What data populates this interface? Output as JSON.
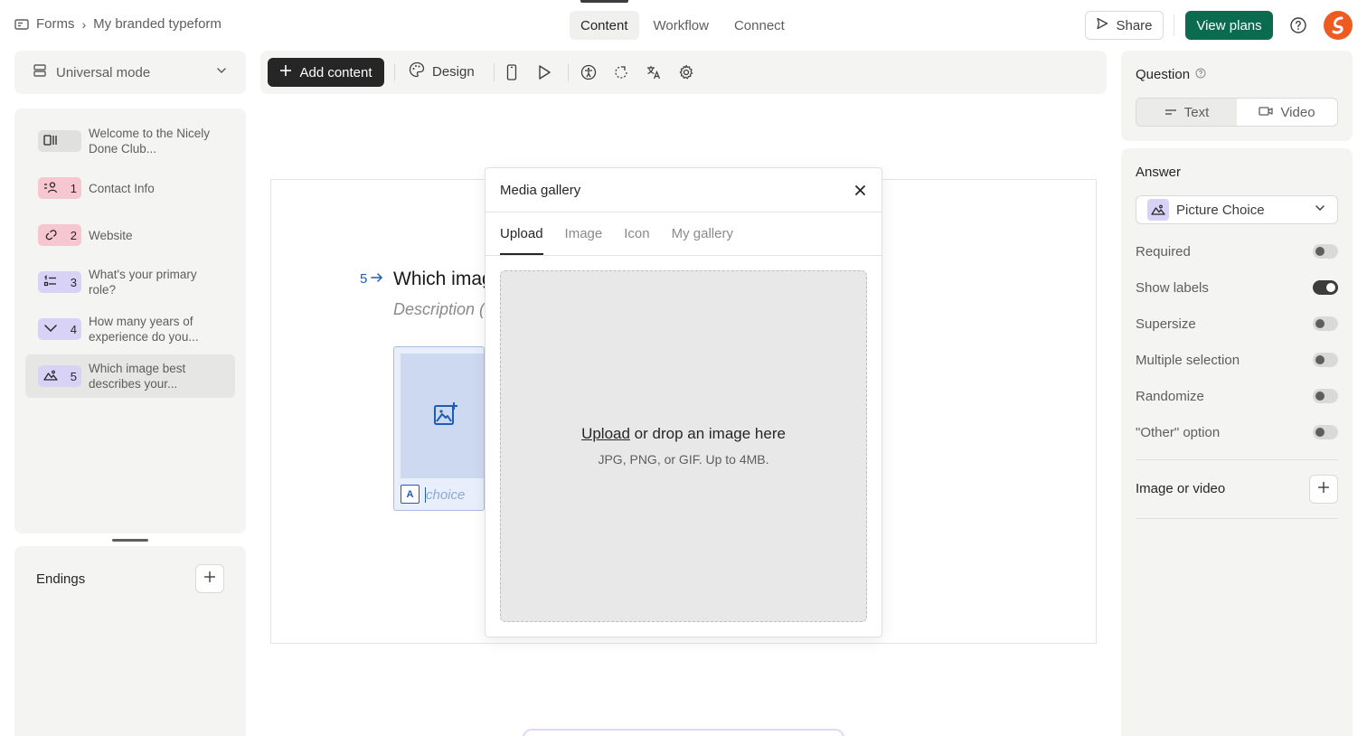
{
  "breadcrumb": {
    "root": "Forms",
    "current": "My branded typeform"
  },
  "header": {
    "tabs": [
      {
        "label": "Content"
      },
      {
        "label": "Workflow"
      },
      {
        "label": "Connect"
      }
    ],
    "share_label": "Share",
    "plans_label": "View plans",
    "brand_color": "#0a6b4f",
    "avatar_color": "#ee5b20"
  },
  "mode": {
    "label": "Universal mode"
  },
  "questions": [
    {
      "num": "",
      "text": "Welcome to the Nicely Done Club...",
      "icon": "welcome-icon",
      "color": "gray"
    },
    {
      "num": "1",
      "text": "Contact Info",
      "icon": "contact-icon",
      "color": "pink"
    },
    {
      "num": "2",
      "text": "Website",
      "icon": "link-icon",
      "color": "pink"
    },
    {
      "num": "3",
      "text": "What's your primary role?",
      "icon": "list-icon",
      "color": "purple"
    },
    {
      "num": "4",
      "text": "How many years of experience do you...",
      "icon": "chevron-down-icon",
      "color": "purple"
    },
    {
      "num": "5",
      "text": "Which image best describes your...",
      "icon": "picture-choice-icon",
      "color": "purple"
    }
  ],
  "endings": {
    "label": "Endings"
  },
  "toolbar": {
    "add_label": "Add content",
    "design_label": "Design"
  },
  "canvas": {
    "q_num": "5",
    "q_title": "Which imag",
    "q_desc": "Description (",
    "choice_key": "A",
    "choice_placeholder": "choice"
  },
  "modal": {
    "title": "Media gallery",
    "tabs": [
      {
        "label": "Upload"
      },
      {
        "label": "Image"
      },
      {
        "label": "Icon"
      },
      {
        "label": "My gallery"
      }
    ],
    "upload_link": "Upload",
    "upload_text": " or drop an image here",
    "upload_sub": "JPG, PNG, or GIF. Up to 4MB."
  },
  "right": {
    "question_label": "Question",
    "seg": [
      {
        "label": "Text"
      },
      {
        "label": "Video"
      }
    ],
    "answer_label": "Answer",
    "answer_type": "Picture Choice",
    "options": [
      {
        "label": "Required",
        "on": false
      },
      {
        "label": "Show labels",
        "on": true
      },
      {
        "label": "Supersize",
        "on": false
      },
      {
        "label": "Multiple selection",
        "on": false
      },
      {
        "label": "Randomize",
        "on": false
      },
      {
        "label": "\"Other\" option",
        "on": false
      }
    ],
    "media_label": "Image or video"
  }
}
